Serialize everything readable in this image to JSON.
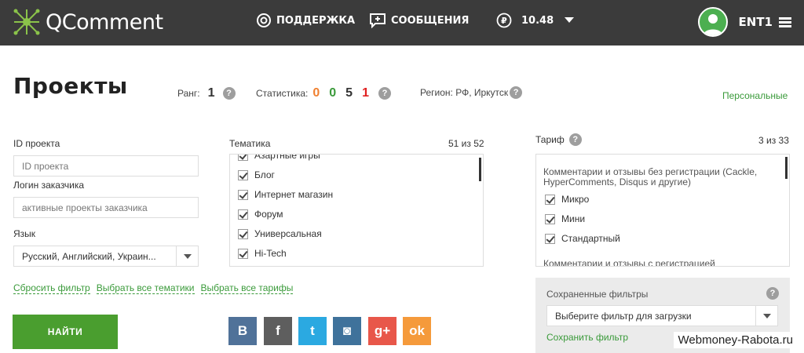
{
  "header": {
    "app_name": "QComment",
    "nav_support": "ПОДДЕРЖКА",
    "nav_messages": "СООБЩЕНИЯ",
    "balance": "10.48",
    "username": "ENT1"
  },
  "page": {
    "title": "Проекты",
    "rank_label": "Ранг:",
    "rank_value": "1",
    "stats_label": "Статистика:",
    "stats": [
      "0",
      "0",
      "5",
      "1"
    ],
    "stats_colors": [
      "#f08030",
      "#3a9a3a",
      "#333333",
      "#e02020"
    ],
    "region_label": "Регион: РФ, Иркутск",
    "personal_link": "Персональные"
  },
  "filters": {
    "project_id_label": "ID проекта",
    "project_id_placeholder": "ID проекта",
    "customer_login_label": "Логин заказчика",
    "customer_login_placeholder": "активные проекты заказчика",
    "language_label": "Язык",
    "language_value": "Русский, Английский, Украин...",
    "reset_link": "Сбросить фильтр",
    "select_all_topics_link": "Выбрать все тематики",
    "select_all_tariffs_link": "Выбрать все тарифы",
    "find_button": "НАЙТИ"
  },
  "topics": {
    "label": "Тематика",
    "count": "51 из 52",
    "items": [
      "Азартные игры",
      "Блог",
      "Интернет магазин",
      "Форум",
      "Универсальная",
      "Hi-Tech"
    ]
  },
  "tariffs": {
    "label": "Тариф",
    "count": "3 из 33",
    "group1": "Комментарии и отзывы без регистрации (Cackle, HyperComments, Disqus и другие)",
    "items": [
      "Микро",
      "Мини",
      "Стандартный"
    ],
    "group2": "Комментарии и отзывы с регистрацией"
  },
  "saved_filters": {
    "label": "Сохраненные фильтры",
    "select_value": "Выберите фильтр для загрузки",
    "save_link": "Сохранить фильтр"
  },
  "social": [
    {
      "icon": "vk-icon",
      "glyph": "B",
      "color": "#507299"
    },
    {
      "icon": "facebook-icon",
      "glyph": "f",
      "color": "#5e5e5e"
    },
    {
      "icon": "twitter-icon",
      "glyph": "t",
      "color": "#2ba9e1"
    },
    {
      "icon": "instagram-icon",
      "glyph": "◙",
      "color": "#3f729b"
    },
    {
      "icon": "google-plus-icon",
      "glyph": "g+",
      "color": "#e8574a"
    },
    {
      "icon": "odnoklassniki-icon",
      "glyph": "ok",
      "color": "#f59a3b"
    }
  ],
  "watermark": "Webmoney-Rabota.ru"
}
